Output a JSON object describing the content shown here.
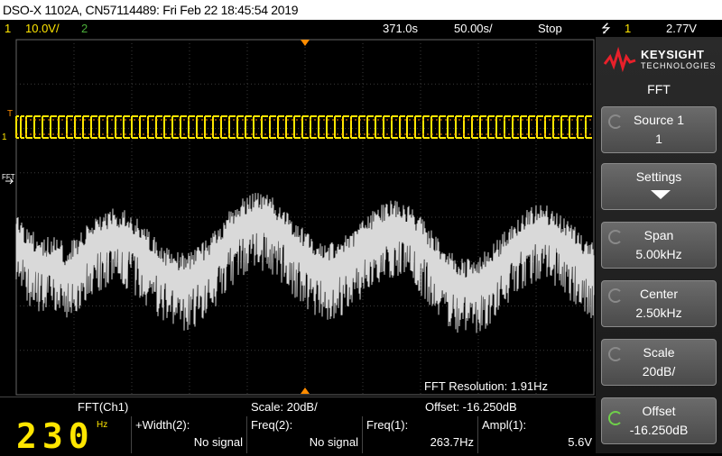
{
  "title": "DSO-X 1102A, CN57114489: Fri Feb 22 18:45:54 2019",
  "status": {
    "ch1_num": "1",
    "ch1_scale": "10.0V/",
    "ch2_num": "2",
    "time_delay": "371.0s",
    "time_scale": "50.00s/",
    "run_state": "Stop",
    "trigger_source": "1",
    "trigger_level": "2.77V"
  },
  "brand": {
    "name": "KEYSIGHT",
    "sub": "TECHNOLOGIES"
  },
  "panel": {
    "title": "FFT",
    "keys": [
      {
        "label": "Source 1",
        "value": "1"
      },
      {
        "label": "Settings",
        "value": ""
      },
      {
        "label": "Span",
        "value": "5.00kHz"
      },
      {
        "label": "Center",
        "value": "2.50kHz"
      },
      {
        "label": "Scale",
        "value": "20dB/"
      },
      {
        "label": "Offset",
        "value": "-16.250dB"
      }
    ]
  },
  "fft_resolution": "FFT Resolution: 1.91Hz",
  "bottom": {
    "source": "FFT(Ch1)",
    "scale": "Scale: 20dB/",
    "offset": "Offset: -16.250dB"
  },
  "counter": {
    "value": "230",
    "unit": "Hz"
  },
  "measurements": [
    {
      "label": "+Width(2):",
      "value": "No signal"
    },
    {
      "label": "Freq(2):",
      "value": "No signal"
    },
    {
      "label": "Freq(1):",
      "value": "263.7Hz"
    },
    {
      "label": "Ampl(1):",
      "value": "5.6V"
    }
  ],
  "colors": {
    "ch1": "#ffe600",
    "ch2": "#4caf3a",
    "fft": "#d9d9d9",
    "trigger": "#ff8c00",
    "grid": "#3a3a3a"
  }
}
